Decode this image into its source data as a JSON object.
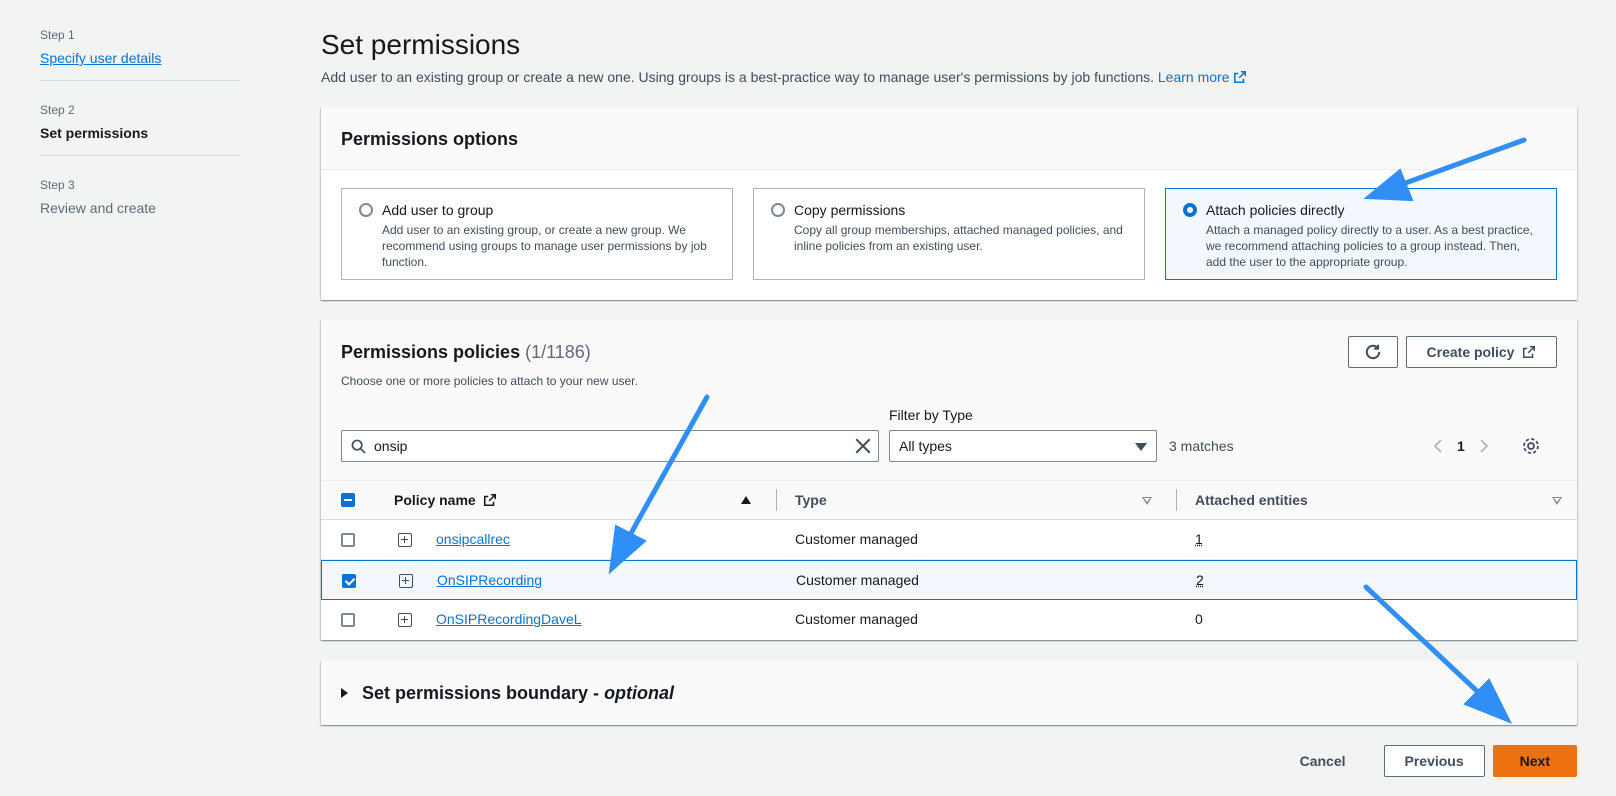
{
  "steps": [
    {
      "num": "Step 1",
      "label": "Specify user details"
    },
    {
      "num": "Step 2",
      "label": "Set permissions"
    },
    {
      "num": "Step 3",
      "label": "Review and create"
    }
  ],
  "header": {
    "title": "Set permissions",
    "description": "Add user to an existing group or create a new one. Using groups is a best-practice way to manage user's permissions by job functions.",
    "learn_more": "Learn more"
  },
  "options": {
    "title": "Permissions options",
    "tiles": [
      {
        "title": "Add user to group",
        "desc": "Add user to an existing group, or create a new group. We recommend using groups to manage user permissions by job function.",
        "selected": false
      },
      {
        "title": "Copy permissions",
        "desc": "Copy all group memberships, attached managed policies, and inline policies from an existing user.",
        "selected": false
      },
      {
        "title": "Attach policies directly",
        "desc": "Attach a managed policy directly to a user. As a best practice, we recommend attaching policies to a group instead. Then, add the user to the appropriate group.",
        "selected": true
      }
    ]
  },
  "policies": {
    "title": "Permissions policies",
    "count": "(1/1186)",
    "subtitle": "Choose one or more policies to attach to your new user.",
    "create_label": "Create policy",
    "search_value": "onsip",
    "filter_label": "Filter by Type",
    "filter_value": "All types",
    "matches": "3 matches",
    "page": "1",
    "columns": {
      "name": "Policy name",
      "type": "Type",
      "entities": "Attached entities"
    },
    "rows": [
      {
        "name": "onsipcallrec",
        "type": "Customer managed",
        "entities": "1",
        "checked": false
      },
      {
        "name": "OnSIPRecording",
        "type": "Customer managed",
        "entities": "2",
        "checked": true
      },
      {
        "name": "OnSIPRecordingDaveL",
        "type": "Customer managed",
        "entities": "0",
        "checked": false
      }
    ]
  },
  "boundary": {
    "title": "Set permissions boundary - ",
    "optional": "optional"
  },
  "actions": {
    "cancel": "Cancel",
    "previous": "Previous",
    "next": "Next"
  },
  "colors": {
    "accent": "#0972d3",
    "primary_button": "#ec7211",
    "annotation_arrow": "#2f8ff7"
  }
}
